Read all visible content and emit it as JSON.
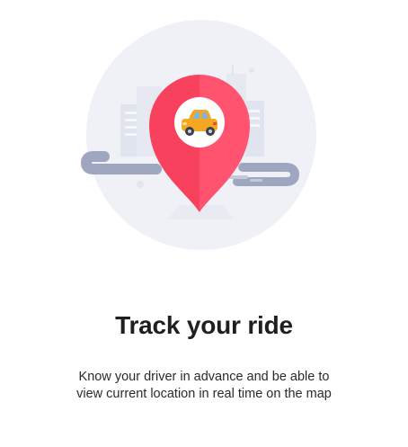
{
  "onboarding": {
    "title": "Track your ride",
    "description": "Know your driver in advance and be able to view current location in real time on the map"
  },
  "illustration": {
    "icons": [
      "map-pin-icon",
      "car-icon"
    ],
    "colors": {
      "backdrop_circle": "#eff1f7",
      "buildings": "#e0e4ef",
      "road": "#9ea6c0",
      "pin_left": "#f8415c",
      "pin_right": "#ff5370",
      "car_body": "#f5a623",
      "car_window": "#7ab6e3"
    }
  }
}
